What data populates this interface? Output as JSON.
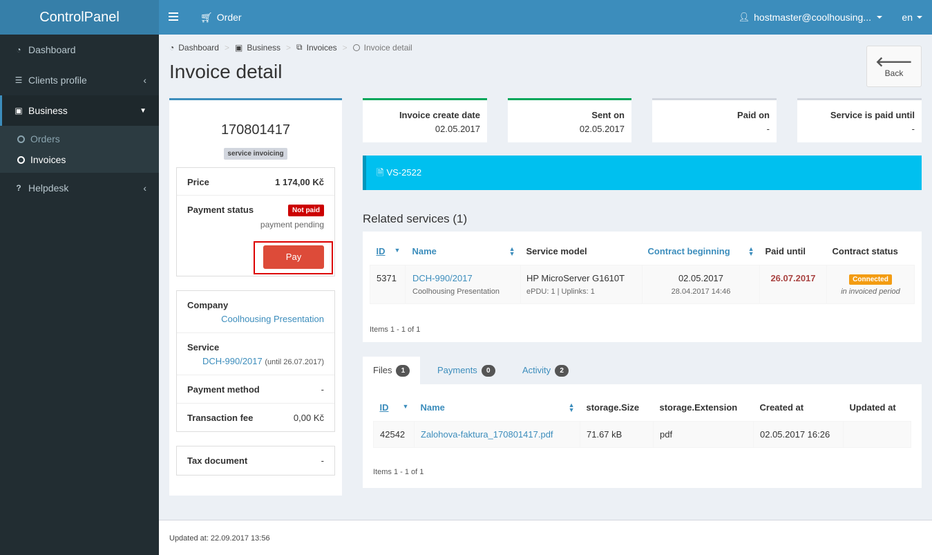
{
  "app": {
    "title": "ControlPanel"
  },
  "navbar": {
    "order_label": "Order",
    "user": "hostmaster@coolhousing...",
    "lang": "en"
  },
  "sidebar": {
    "items": [
      {
        "label": "Dashboard",
        "icon": "dashboard-icon"
      },
      {
        "label": "Clients profile",
        "icon": "list-icon"
      },
      {
        "label": "Business",
        "icon": "money-icon"
      },
      {
        "label": "Helpdesk",
        "icon": "question-icon"
      }
    ],
    "business_sub": [
      {
        "label": "Orders"
      },
      {
        "label": "Invoices"
      }
    ]
  },
  "breadcrumb": [
    {
      "label": "Dashboard"
    },
    {
      "label": "Business"
    },
    {
      "label": "Invoices"
    },
    {
      "label": "Invoice detail"
    }
  ],
  "page": {
    "title": "Invoice detail",
    "back_label": "Back"
  },
  "invoice": {
    "number": "170801417",
    "type_label": "service invoicing",
    "price_label": "Price",
    "price_value": "1 174,00 Kč",
    "payment_status_label": "Payment status",
    "payment_status_badge": "Not paid",
    "payment_status_note": "payment pending",
    "pay_label": "Pay",
    "company_label": "Company",
    "company_value": "Coolhousing Presentation",
    "service_label": "Service",
    "service_value": "DCH-990/2017",
    "service_until": "(until 26.07.2017)",
    "payment_method_label": "Payment method",
    "payment_method_value": "-",
    "transaction_fee_label": "Transaction fee",
    "transaction_fee_value": "0,00 Kč",
    "tax_document_label": "Tax document",
    "tax_document_value": "-"
  },
  "info_boxes": [
    {
      "title": "Invoice create date",
      "value": "02.05.2017",
      "color": "#00a65a"
    },
    {
      "title": "Sent on",
      "value": "02.05.2017",
      "color": "#00a65a"
    },
    {
      "title": "Paid on",
      "value": "-",
      "color": "#d2d6de"
    },
    {
      "title": "Service is paid until",
      "value": "-",
      "color": "#d2d6de"
    }
  ],
  "vs": {
    "label": "VS-2522"
  },
  "related": {
    "title": "Related services (1)",
    "headers": [
      "ID",
      "Name",
      "Service model",
      "Contract beginning",
      "Paid until",
      "Contract status"
    ],
    "row": {
      "id": "5371",
      "name": "DCH-990/2017",
      "name_sub": "Coolhousing Presentation",
      "model": "HP MicroServer G1610T",
      "model_sub": "ePDU: 1 | Uplinks: 1",
      "contract": "02.05.2017",
      "contract_sub": "28.04.2017 14:46",
      "paid_until": "26.07.2017",
      "status_badge": "Connected",
      "status_note": "in invoiced period"
    },
    "footer": "Items 1 - 1 of 1"
  },
  "tabs": [
    {
      "label": "Files",
      "count": "1"
    },
    {
      "label": "Payments",
      "count": "0"
    },
    {
      "label": "Activity",
      "count": "2"
    }
  ],
  "files": {
    "headers": [
      "ID",
      "Name",
      "storage.Size",
      "storage.Extension",
      "Created at",
      "Updated at"
    ],
    "row": {
      "id": "42542",
      "name": "Zalohova-faktura_170801417.pdf",
      "size": "71.67 kB",
      "ext": "pdf",
      "created": "02.05.2017 16:26",
      "updated": ""
    },
    "footer": "Items 1 - 1 of 1"
  },
  "footer": {
    "updated": "Updated at: 22.09.2017 13:56"
  },
  "colors": {
    "accent": "#3c8dbc",
    "sidebar": "#222d32",
    "danger": "#dd4b39",
    "info": "#00c0ef",
    "success": "#00a65a",
    "warning": "#f39c12"
  }
}
